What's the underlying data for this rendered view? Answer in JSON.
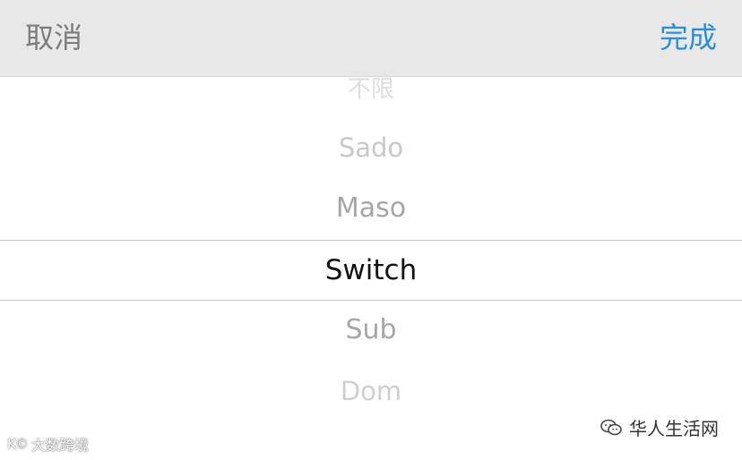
{
  "toolbar": {
    "cancel_label": "取消",
    "done_label": "完成",
    "background_color": "#e8e8e8",
    "done_color": "#2b8fd8",
    "cancel_color": "#7c7c7c"
  },
  "picker": {
    "options": [
      "不限",
      "Sado",
      "Maso",
      "Switch",
      "Sub",
      "Dom"
    ],
    "selected": "Switch"
  },
  "watermarks": {
    "left_text": "大数跨境",
    "left_logo_icon": "kfc-logo-icon",
    "right_text": "华人生活网",
    "right_icon": "wechat-icon"
  }
}
